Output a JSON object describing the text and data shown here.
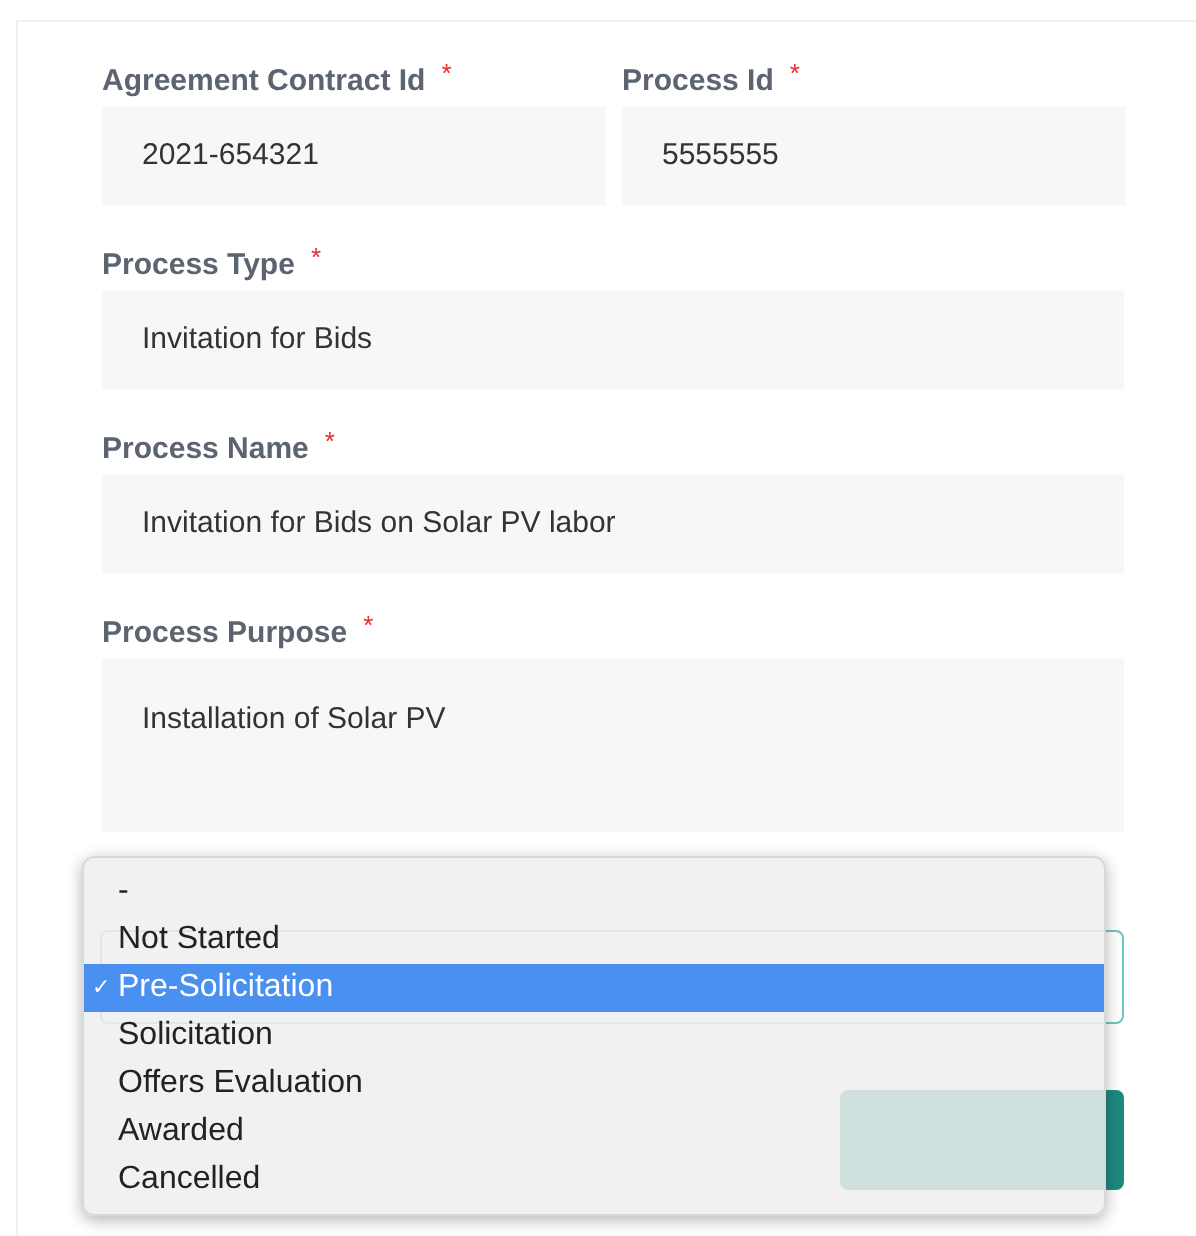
{
  "fields": [
    {
      "label": "Agreement Contract Id",
      "required_mark": "*",
      "value": "2021-654321",
      "kind": "input"
    },
    {
      "label": "Process Id",
      "required_mark": "*",
      "value": "5555555",
      "kind": "input"
    },
    {
      "label": "Process Type",
      "required_mark": "*",
      "value": "Invitation for Bids",
      "kind": "input"
    },
    {
      "label": "Process Name",
      "required_mark": "*",
      "value": "Invitation for Bids on Solar PV labor",
      "kind": "input"
    },
    {
      "label": "Process Purpose",
      "required_mark": "*",
      "value": "Installation of Solar PV",
      "kind": "textarea"
    }
  ],
  "dropdown": {
    "check_mark": "✓",
    "options": [
      {
        "label": "-",
        "selected": false
      },
      {
        "label": "Not Started",
        "selected": false
      },
      {
        "label": "Pre-Solicitation",
        "selected": true
      },
      {
        "label": "Solicitation",
        "selected": false
      },
      {
        "label": "Offers Evaluation",
        "selected": false
      },
      {
        "label": "Awarded",
        "selected": false
      },
      {
        "label": "Cancelled",
        "selected": false
      }
    ]
  }
}
